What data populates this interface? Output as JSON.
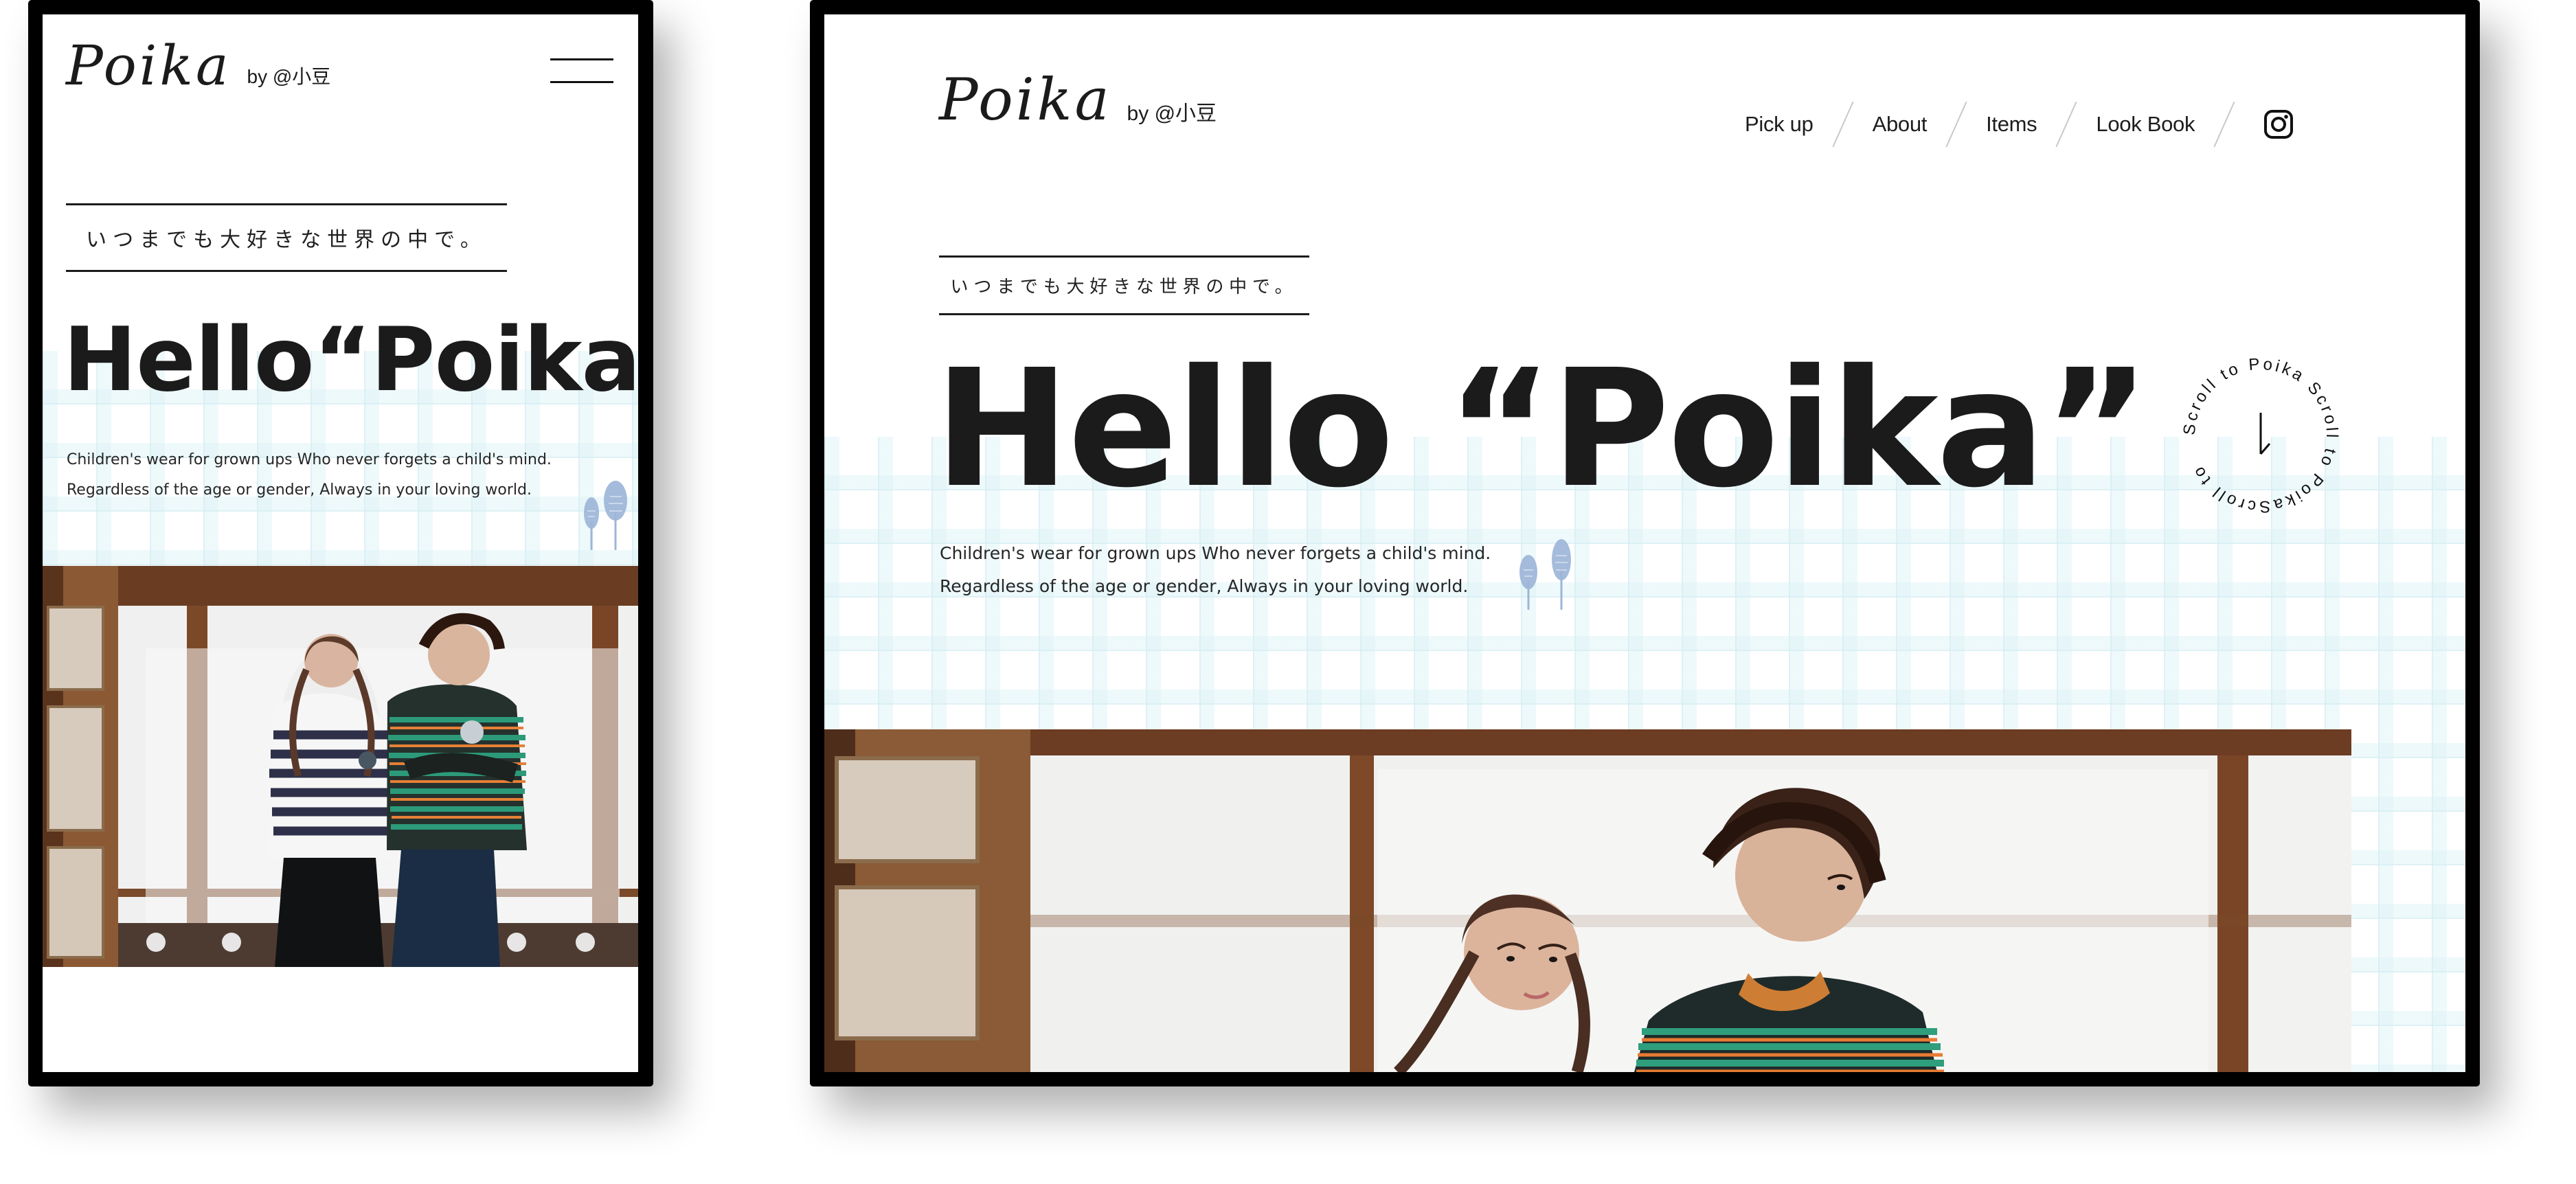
{
  "mobile": {
    "brand": {
      "logo": "Poika",
      "by": "by @小豆"
    },
    "menu": {
      "icon": "hamburger-menu-icon"
    },
    "catchphrase": "いつまでも大好きな世界の中で。",
    "headline": "Hello“Poika”",
    "intro": {
      "line1": "Children's wear for grown ups Who never forgets a child's mind.",
      "line2": "Regardless of the age or gender, Always in your loving world."
    },
    "decoration": {
      "icon": "tree-icon"
    },
    "photo": {
      "name": "hero-photo"
    }
  },
  "desktop": {
    "brand": {
      "logo": "Poika",
      "by": "by @小豆"
    },
    "nav": {
      "items": [
        "Pick up",
        "About",
        "Items",
        "Look Book"
      ],
      "social_icon": "instagram-icon"
    },
    "catchphrase": "いつまでも大好きな世界の中で。",
    "headline": "Hello “Poika”",
    "intro": {
      "line1": "Children's wear for grown ups Who never forgets a child's mind.",
      "line2": "Regardless of the age or gender, Always in your loving world."
    },
    "scroll_badge": {
      "text": "Scroll to Poika Scroll to PoikaScroll to",
      "icon": "arrow-down-icon"
    },
    "decoration": {
      "icon": "tree-icon"
    },
    "photo": {
      "name": "hero-photo"
    }
  },
  "colors": {
    "frame": "#000000",
    "text": "#1b1b1b",
    "grid": "#d8eff2",
    "tree": "#9db5d8",
    "wood": "#7b4928"
  }
}
